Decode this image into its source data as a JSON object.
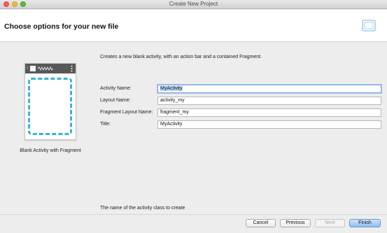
{
  "window": {
    "title": "Create New Project"
  },
  "header": {
    "title": "Choose options for your new file"
  },
  "template": {
    "name": "Blank Activity with Fragment"
  },
  "description": "Creates a new blank activity, with an action bar and a contained Fragment.",
  "fields": [
    {
      "label": "Activity Name:",
      "value": "MyActivity"
    },
    {
      "label": "Layout Name:",
      "value": "activity_my"
    },
    {
      "label": "Fragment Layout Name:",
      "value": "fragment_my"
    },
    {
      "label": "Title:",
      "value": "MyActivity"
    }
  ],
  "hint": "The name of the activity class to create",
  "buttons": {
    "cancel": "Cancel",
    "previous": "Previous",
    "next": "Next",
    "finish": "Finish"
  },
  "colors": {
    "accent": "#37b4d6",
    "selection": "#b4d4fb",
    "default_button": "#8fbcef"
  }
}
